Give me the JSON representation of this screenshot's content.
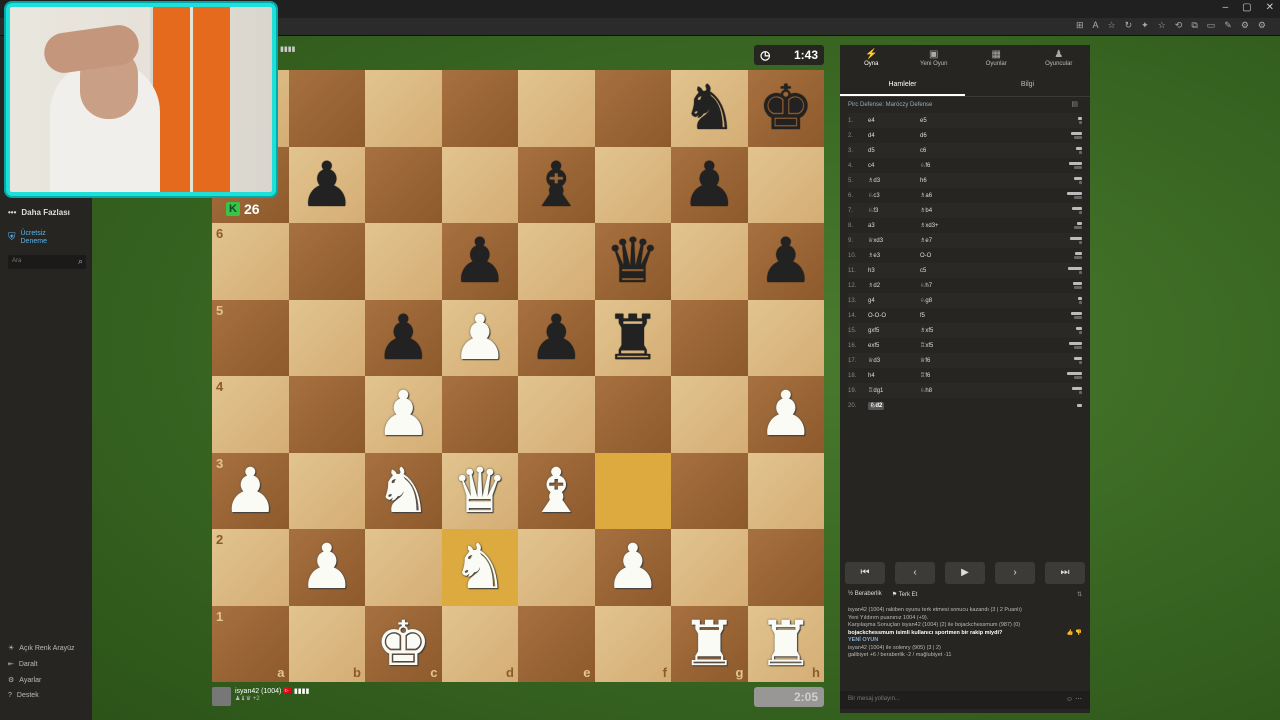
{
  "window": {
    "controls": [
      "–",
      "▢",
      "✕"
    ],
    "toolbar_icons": [
      "⊞",
      "A",
      "☆",
      "↻",
      "✦",
      "☆",
      "⟲",
      "⧉",
      "▭",
      "✎",
      "⚙",
      "⚙"
    ]
  },
  "sidebar": {
    "more_label": "Daha Fazlası",
    "trial_label_1": "Ücretsiz",
    "trial_label_2": "Deneme",
    "search_placeholder": "Ara",
    "bottom": [
      {
        "icon": "☀",
        "label": "Açık Renk Arayüz"
      },
      {
        "icon": "⇤",
        "label": "Daralt"
      },
      {
        "icon": "⚙",
        "label": "Ayarlar"
      },
      {
        "icon": "?",
        "label": "Destek"
      }
    ]
  },
  "opponent": {
    "rating_badge": "K",
    "rating": "26",
    "flag_text": "▮▮▮▮",
    "clock": "1:43"
  },
  "player": {
    "name": "isyan42 (1004)",
    "flag": "🇹🇷 ▮▮▮▮",
    "captured": "♟♝♛ +2",
    "clock": "2:05"
  },
  "board": {
    "files": [
      "a",
      "b",
      "c",
      "d",
      "e",
      "f",
      "g",
      "h"
    ],
    "ranks": [
      "8",
      "7",
      "6",
      "5",
      "4",
      "3",
      "2",
      "1"
    ],
    "position": [
      [
        "",
        "",
        "",
        "",
        "",
        "",
        "bN",
        "bK"
      ],
      [
        "",
        "bP",
        "",
        "",
        "bB",
        "",
        "bP",
        ""
      ],
      [
        "",
        "",
        "",
        "bP",
        "",
        "bQ",
        "",
        "bP"
      ],
      [
        "",
        "",
        "bP",
        "wP",
        "bP",
        "bR",
        "",
        ""
      ],
      [
        "",
        "",
        "wP",
        "",
        "",
        "",
        "",
        "wP"
      ],
      [
        "wP",
        "",
        "wN",
        "wQ",
        "wB",
        "",
        "",
        ""
      ],
      [
        "",
        "wP",
        "",
        "wN",
        "",
        "wP",
        "",
        ""
      ],
      [
        "",
        "",
        "wK",
        "",
        "",
        "",
        "wR",
        "wR"
      ]
    ],
    "highlight": [
      "f3",
      "d2"
    ]
  },
  "panel": {
    "nav": [
      {
        "icon": "⚡",
        "label": "Oyna",
        "active": true
      },
      {
        "icon": "▣",
        "label": "Yeni Oyun"
      },
      {
        "icon": "▦",
        "label": "Oyunlar"
      },
      {
        "icon": "♟",
        "label": "Oyuncular"
      }
    ],
    "tabs": [
      {
        "label": "Hamleler",
        "active": true
      },
      {
        "label": "Bilgi"
      }
    ],
    "opening": "Pirc Defense: Maróczy Defense",
    "moves": [
      [
        "1.",
        "e4",
        "e5"
      ],
      [
        "2.",
        "d4",
        "d6"
      ],
      [
        "3.",
        "d5",
        "c6"
      ],
      [
        "4.",
        "c4",
        "♘f6"
      ],
      [
        "5.",
        "♗d3",
        "h6"
      ],
      [
        "6.",
        "♘c3",
        "♗a6"
      ],
      [
        "7.",
        "♘f3",
        "♗b4"
      ],
      [
        "8.",
        "a3",
        "♗xd3+"
      ],
      [
        "9.",
        "♕xd3",
        "♗e7"
      ],
      [
        "10.",
        "♗e3",
        "O-O"
      ],
      [
        "11.",
        "h3",
        "c5"
      ],
      [
        "12.",
        "♗d2",
        "♘h7"
      ],
      [
        "13.",
        "g4",
        "♘g8"
      ],
      [
        "14.",
        "O-O-O",
        "f5"
      ],
      [
        "15.",
        "gxf5",
        "♗xf5"
      ],
      [
        "16.",
        "exf5",
        "♖xf5"
      ],
      [
        "17.",
        "♕d3",
        "♕f6"
      ],
      [
        "18.",
        "h4",
        "♖f6"
      ],
      [
        "19.",
        "♖dg1",
        "♘h8"
      ],
      [
        "20.",
        "♘d2",
        ""
      ]
    ],
    "controls": [
      "⏮",
      "‹",
      "▶",
      "›",
      "⏭"
    ],
    "draw_label": "Beraberlik",
    "resign_label": "Terk Et",
    "chat": [
      "isyan42 (1004) rakiben oyunu terk etmesi sonucu kazandı (3 | 2 Puanlı)",
      "Yeni Yıldırım puanınız 1004 (+9).",
      "Karşılaşma Sonuçları isyan42 (1004) (2) ile bojackchessmum (987) (0)",
      "bojackchessmum isimli kullanıcı sportmen bir rakip miydi?",
      "YENİ OYUN",
      "isyan42 (1004) ile solenry (905) (3 | 2)",
      "galibiyet +6 / beraberlik -2 / mağlubiyet -11"
    ],
    "chat_placeholder": "Bir mesaj yollayın..."
  }
}
